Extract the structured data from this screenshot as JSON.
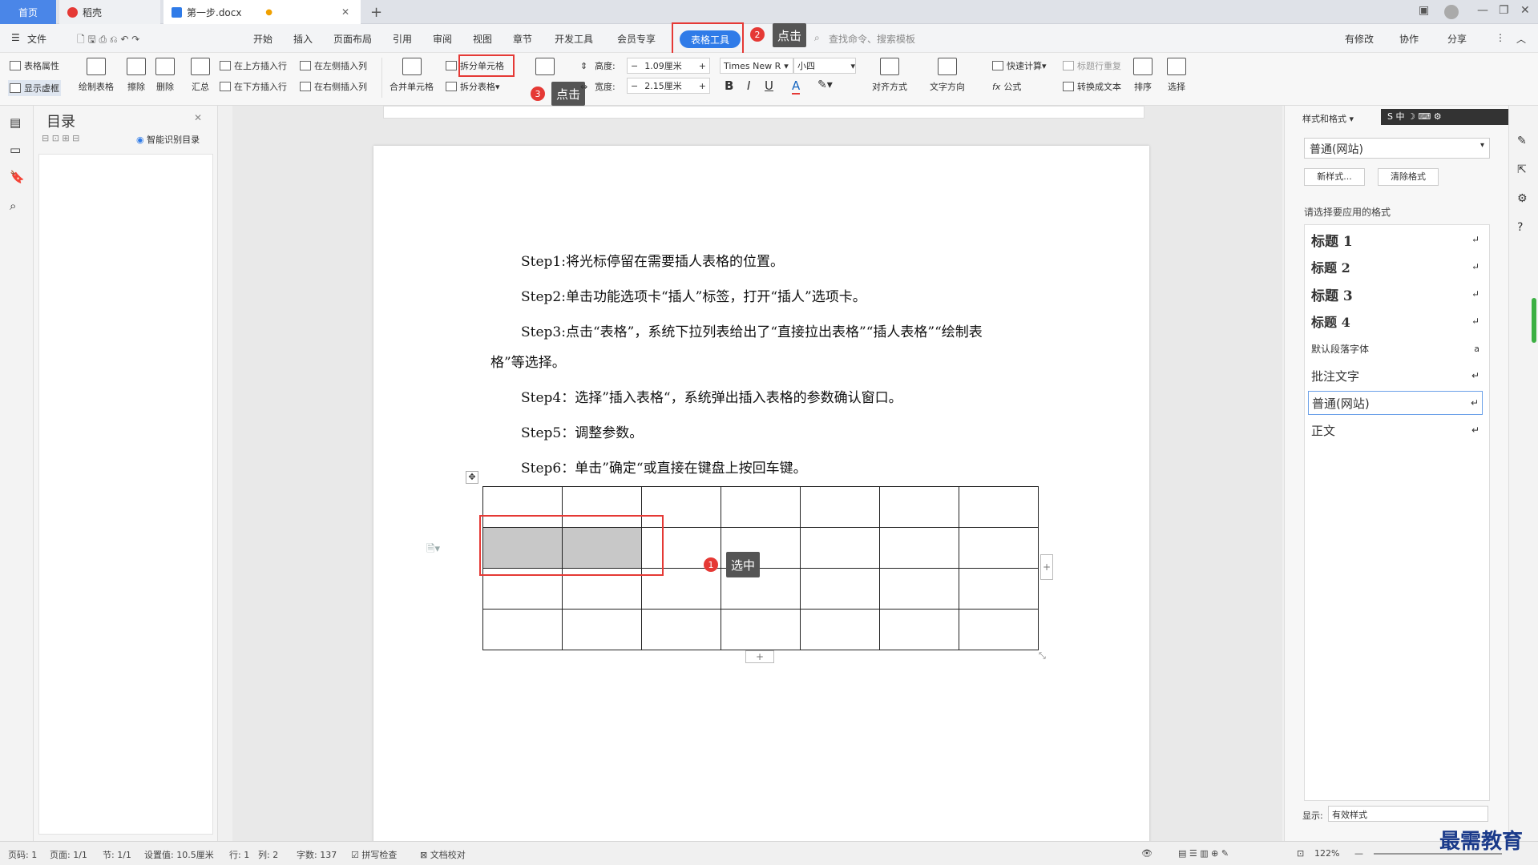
{
  "titlebar": {
    "home": "首页",
    "tab1": "稻壳",
    "tab2": "第一步.docx",
    "plus": "+"
  },
  "menu": {
    "file": "文件",
    "items": [
      "开始",
      "插入",
      "页面布局",
      "引用",
      "审阅",
      "视图",
      "章节",
      "开发工具",
      "会员专享"
    ],
    "active": "表格工具",
    "search": "查找命令、搜索模板",
    "right": [
      "有修改",
      "协作",
      "分享"
    ]
  },
  "ribbon": {
    "table_props": "表格属性",
    "show_grid": "显示虚框",
    "draw_table": "绘制表格",
    "erase": "擦除",
    "delete": "删除",
    "summary": "汇总",
    "ins_above": "在上方插入行",
    "ins_below": "在下方插入行",
    "ins_left": "在左侧插入列",
    "ins_right": "在右侧插入列",
    "merge": "合并单元格",
    "split_cell": "拆分单元格",
    "split_table": "拆分表格",
    "height_label": "高度:",
    "height_val": "1.09厘米",
    "width_label": "宽度:",
    "width_val": "2.15厘米",
    "font": "Times New R",
    "size": "小四",
    "bold": "B",
    "italic": "I",
    "underline": "U",
    "fontcolor": "A",
    "align": "对齐方式",
    "textdir": "文字方向",
    "quickcalc": "快速计算",
    "formula": "公式",
    "repeat_title": "标题行重复",
    "to_text": "转换成文本",
    "sort": "排序",
    "select": "选择"
  },
  "callouts": {
    "c1": "选中",
    "c2": "点击",
    "c3": "点击",
    "n1": "1",
    "n2": "2",
    "n3": "3"
  },
  "toc": {
    "title": "目录",
    "smart": "智能识别目录"
  },
  "document": {
    "paras": [
      "Step1:将光标停留在需要插人表格的位置。",
      "Step2:单击功能选项卡“插人”标签，打开“插人”选项卡。",
      "Step3:点击“表格”，系统下拉列表给出了“直接拉出表格”“插人表格”“绘制表",
      "格”等选择。",
      "Step4：选择”插入表格“，系统弹出插入表格的参数确认窗口。",
      "Step5：调整参数。",
      "Step6：单击”确定“或直接在键盘上按回车键。"
    ]
  },
  "styles_panel": {
    "header": "样式和格式",
    "current": "普通(网站)",
    "new": "新样式...",
    "clear": "清除格式",
    "prompt": "请选择要应用的格式",
    "items": [
      "标题  1",
      "标题  2",
      "标题  3",
      "标题  4",
      "默认段落字体",
      "批注文字",
      "普通(网站)",
      "正文"
    ],
    "show_label": "显示:",
    "show_val": "有效样式"
  },
  "status": {
    "page": "页码: 1",
    "pages": "页面: 1/1",
    "section": "节: 1/1",
    "setting": "设置值: 10.5厘米",
    "row": "行: 1",
    "col": "列: 2",
    "words": "字数: 137",
    "spell": "拼写检查",
    "proof": "文档校对",
    "zoom": "122%"
  },
  "watermark": "最需教育"
}
